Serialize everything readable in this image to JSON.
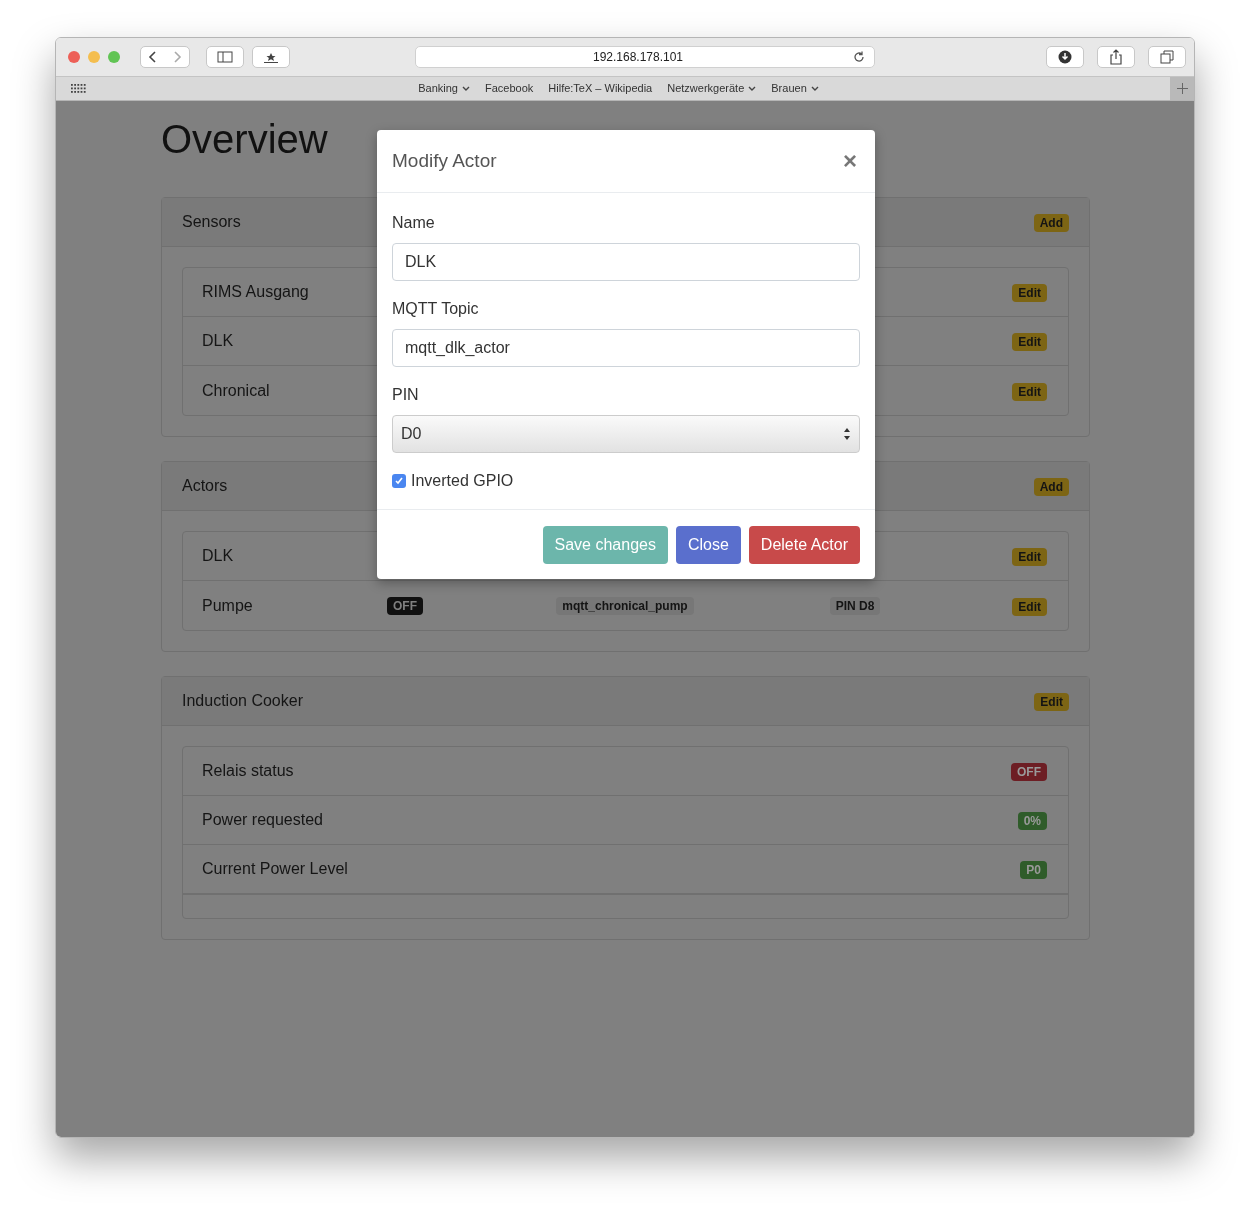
{
  "browser": {
    "url": "192.168.178.101",
    "bookmarks": [
      {
        "label": "Banking",
        "menu": true
      },
      {
        "label": "Facebook",
        "menu": false
      },
      {
        "label": "Hilfe:TeX – Wikipedia",
        "menu": false
      },
      {
        "label": "Netzwerkgeräte",
        "menu": true
      },
      {
        "label": "Brauen",
        "menu": true
      }
    ]
  },
  "page": {
    "heading": "Overview",
    "panels": [
      {
        "title": "Sensors",
        "badge": {
          "text": "Add",
          "kind": "warning"
        },
        "rows": [
          {
            "name": "RIMS Ausgang",
            "cells": [],
            "action": {
              "text": "Edit",
              "kind": "warning"
            }
          },
          {
            "name": "DLK",
            "cells": [],
            "action": {
              "text": "Edit",
              "kind": "warning"
            }
          },
          {
            "name": "Chronical",
            "cells": [],
            "action": {
              "text": "Edit",
              "kind": "warning"
            }
          }
        ],
        "trailing_blank": false
      },
      {
        "title": "Actors",
        "badge": {
          "text": "Add",
          "kind": "warning"
        },
        "rows": [
          {
            "name": "DLK",
            "cells": [],
            "action": {
              "text": "Edit",
              "kind": "warning"
            }
          },
          {
            "name": "Pumpe",
            "cells": [
              {
                "text": "OFF",
                "kind": "dark"
              },
              {
                "text": "mqtt_chronical_pump",
                "kind": "light"
              },
              {
                "text": "PIN D8",
                "kind": "light"
              }
            ],
            "action": {
              "text": "Edit",
              "kind": "warning"
            }
          }
        ],
        "trailing_blank": false
      },
      {
        "title": "Induction Cooker",
        "badge": {
          "text": "Edit",
          "kind": "warning"
        },
        "rows": [
          {
            "name": "Relais status",
            "cells": [],
            "action": {
              "text": "OFF",
              "kind": "danger"
            }
          },
          {
            "name": "Power requested",
            "cells": [],
            "action": {
              "text": "0%",
              "kind": "success"
            }
          },
          {
            "name": "Current Power Level",
            "cells": [],
            "action": {
              "text": "P0",
              "kind": "success"
            }
          }
        ],
        "trailing_blank": true
      }
    ]
  },
  "modal": {
    "title": "Modify Actor",
    "close": "×",
    "fields": [
      {
        "kind": "text",
        "label": "Name",
        "value": "DLK"
      },
      {
        "kind": "text",
        "label": "MQTT Topic",
        "value": "mqtt_dlk_actor"
      },
      {
        "kind": "select",
        "label": "PIN",
        "value": "D0"
      },
      {
        "kind": "checkbox",
        "label": "Inverted GPIO",
        "checked": true
      }
    ],
    "buttons": [
      {
        "label": "Save changes",
        "kind": "save"
      },
      {
        "label": "Close",
        "kind": "close"
      },
      {
        "label": "Delete Actor",
        "kind": "danger"
      }
    ]
  }
}
